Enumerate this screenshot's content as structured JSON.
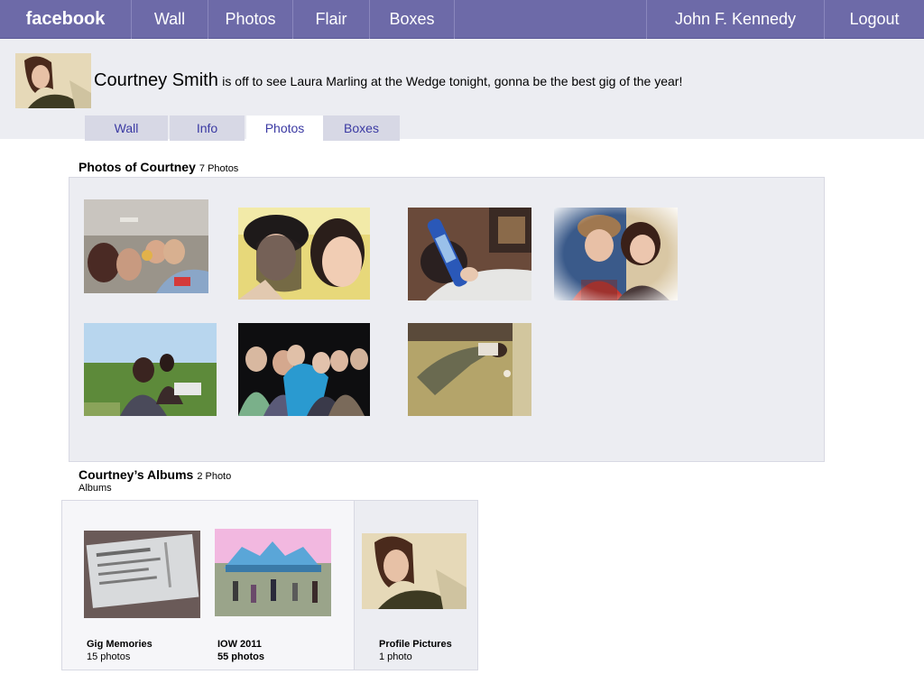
{
  "nav": {
    "brand": "facebook",
    "items": [
      "Wall",
      "Photos",
      "Flair",
      "Boxes"
    ],
    "user": "John F. Kennedy",
    "logout": "Logout"
  },
  "profile": {
    "name": "Courtney Smith",
    "status": "is off to see Laura Marling at the Wedge tonight, gonna be the best gig of the year!",
    "tabs": [
      "Wall",
      "Info",
      "Photos",
      "Boxes"
    ],
    "active_tab": "Photos"
  },
  "photos_section": {
    "title": "Photos of Courtney",
    "count": "7 Photos"
  },
  "albums_section": {
    "title": "Courtney’s Albums",
    "count": "2 Photo",
    "count_line2": "Albums",
    "albums": [
      {
        "name": "Gig Memories",
        "count": "15 photos"
      },
      {
        "name": "IOW 2011",
        "count": "55 photos"
      },
      {
        "name": "Profile Pictures",
        "count": "1 photo"
      }
    ]
  },
  "colors": {
    "nav_bg": "#6d6aa8",
    "tab_text": "#3b3aa3",
    "panel_bg": "#ecedf2"
  }
}
